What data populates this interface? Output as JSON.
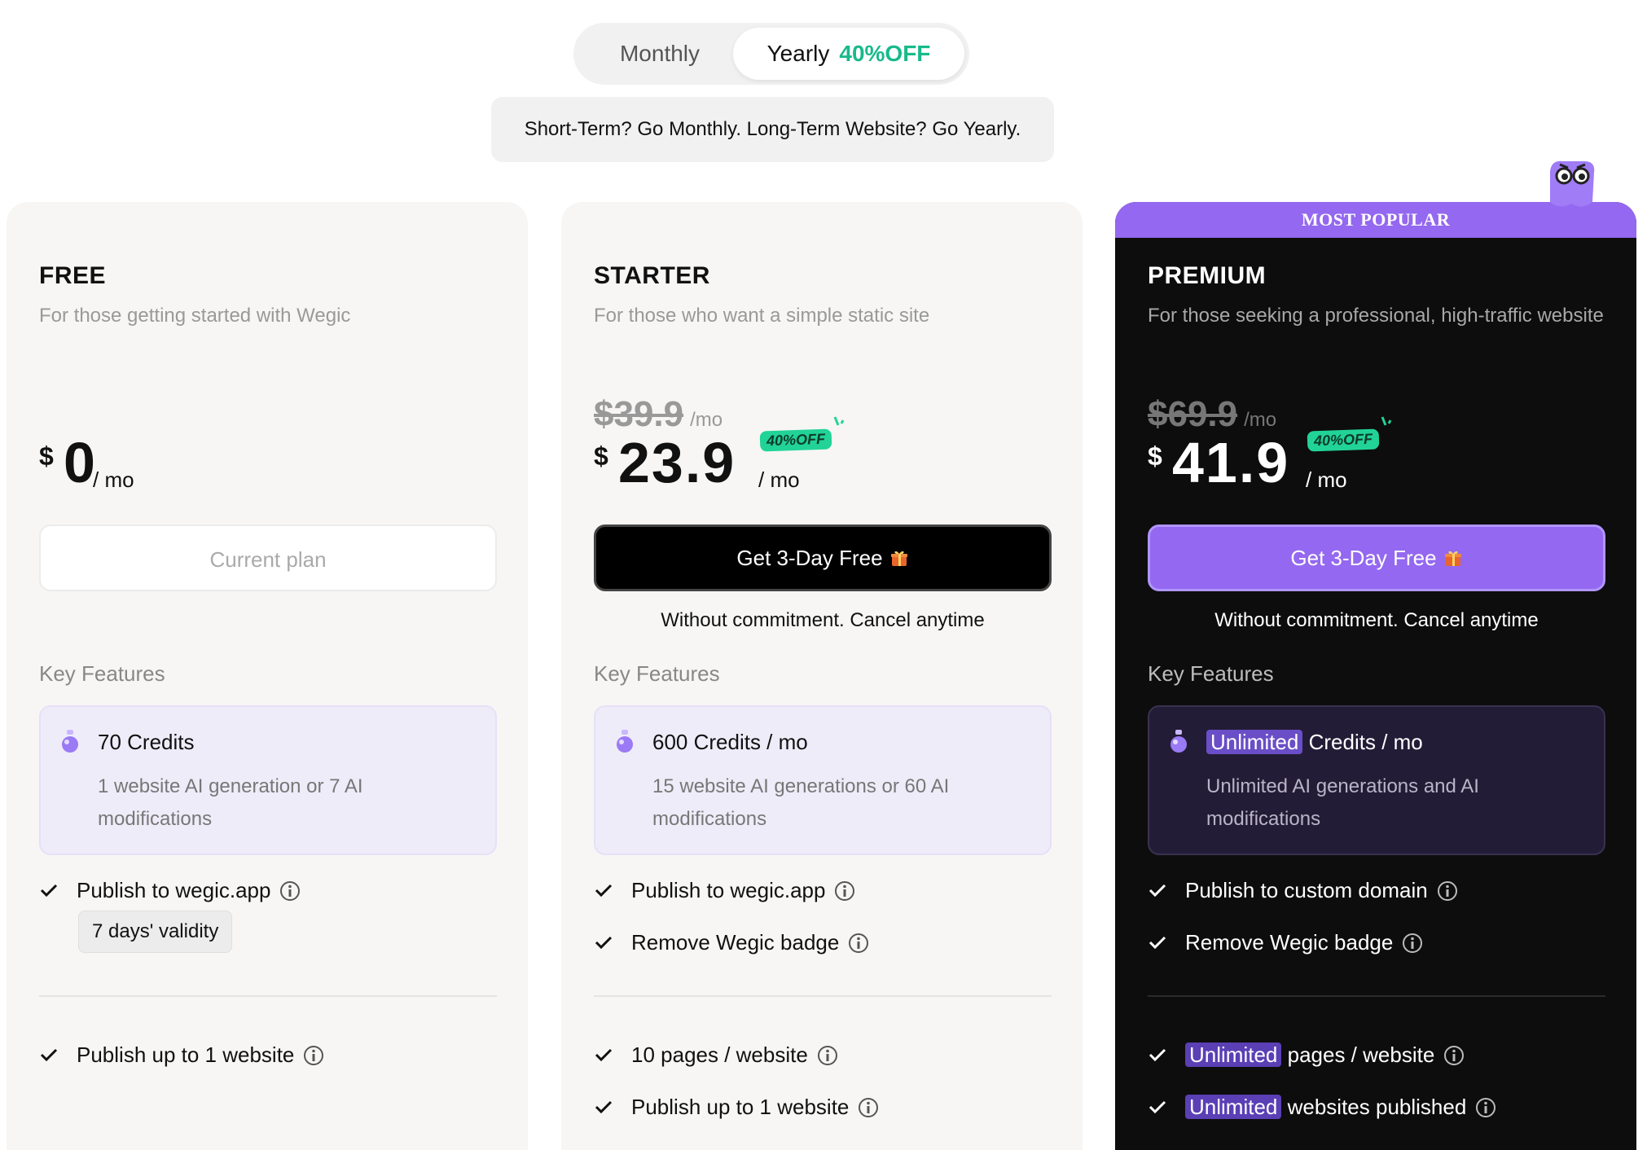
{
  "billing": {
    "monthly_label": "Monthly",
    "yearly_label": "Yearly",
    "yearly_badge": "40%OFF",
    "hint": "Short-Term? Go Monthly. Long-Term Website? Go Yearly.",
    "selected": "Yearly"
  },
  "colors": {
    "accent_purple": "#9468f0",
    "discount_green": "#22d398",
    "premium_bg": "#0d0d0d"
  },
  "plans": [
    {
      "name": "FREE",
      "description": "For those getting started with Wegic",
      "currency": "$",
      "price": "0",
      "per": "/ mo",
      "button_label": "Current plan",
      "key_features_label": "Key Features",
      "credits_title": "70 Credits",
      "credits_desc": "1 website AI generation or 7 AI modifications",
      "features": [
        "Publish to wegic.app"
      ],
      "validity_tag": "7 days' validity",
      "features_bottom": [
        "Publish up to 1 website"
      ]
    },
    {
      "name": "STARTER",
      "description": "For those who want a simple static site",
      "old_price": "$39.9",
      "old_per": "/mo",
      "currency": "$",
      "price": "23.9",
      "per": "/ mo",
      "discount_badge": "40%OFF",
      "button_label": "Get 3-Day Free",
      "no_commitment": "Without commitment. Cancel anytime",
      "key_features_label": "Key Features",
      "credits_title": "600 Credits / mo",
      "credits_desc": "15 website AI generations or 60 AI modifications",
      "features": [
        "Publish to wegic.app",
        "Remove Wegic badge"
      ],
      "features_bottom": [
        "10 pages / website",
        "Publish up to 1 website"
      ]
    },
    {
      "name": "PREMIUM",
      "ribbon": "MOST POPULAR",
      "description": "For those seeking a professional, high-traffic website",
      "old_price": "$69.9",
      "old_per": "/mo",
      "currency": "$",
      "price": "41.9",
      "per": "/ mo",
      "discount_badge": "40%OFF",
      "button_label": "Get 3-Day Free",
      "no_commitment": "Without commitment. Cancel anytime",
      "key_features_label": "Key Features",
      "credits_highlight": "Unlimited",
      "credits_title_rest": "Credits / mo",
      "credits_desc": "Unlimited AI generations and AI modifications",
      "features": [
        "Publish to custom domain",
        "Remove Wegic badge"
      ],
      "bottom_highlight": "Unlimited",
      "features_bottom_rest": [
        "pages / website",
        "websites published"
      ]
    }
  ]
}
